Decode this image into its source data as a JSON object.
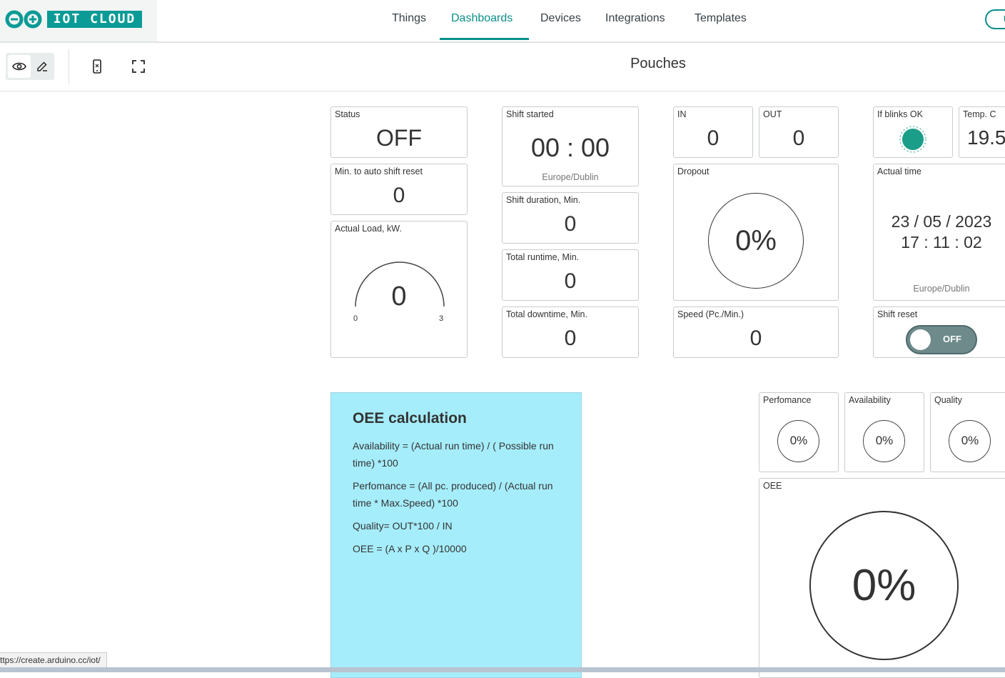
{
  "app": {
    "logo_text": "IOT CLOUD"
  },
  "nav": {
    "items": [
      {
        "label": "Things"
      },
      {
        "label": "Dashboards"
      },
      {
        "label": "Devices"
      },
      {
        "label": "Integrations"
      },
      {
        "label": "Templates"
      }
    ],
    "active": "Dashboards",
    "right_button_label": "U"
  },
  "toolbar": {
    "dashboard_title": "Pouches"
  },
  "widgets": {
    "status": {
      "label": "Status",
      "value": "OFF"
    },
    "auto_reset": {
      "label": "Min. to auto shift reset",
      "value": "0"
    },
    "actual_load": {
      "label": "Actual Load, kW.",
      "value": "0",
      "min": "0",
      "max": "3"
    },
    "shift_started": {
      "label": "Shift started",
      "value": "00 : 00",
      "timezone": "Europe/Dublin"
    },
    "shift_duration": {
      "label": "Shift duration, Min.",
      "value": "0"
    },
    "total_runtime": {
      "label": "Total runtime, Min.",
      "value": "0"
    },
    "total_downtime": {
      "label": "Total downtime, Min.",
      "value": "0"
    },
    "in": {
      "label": "IN",
      "value": "0"
    },
    "out": {
      "label": "OUT",
      "value": "0"
    },
    "dropout": {
      "label": "Dropout",
      "value": "0%"
    },
    "speed": {
      "label": "Speed (Pc./Min.)",
      "value": "0"
    },
    "blink": {
      "label": "If blinks OK",
      "color": "#1a9e8a"
    },
    "temp": {
      "label": "Temp. C",
      "value": "19.5"
    },
    "actual_time": {
      "label": "Actual time",
      "date": "23 / 05 / 2023",
      "time": "17 : 11 : 02",
      "timezone": "Europe/Dublin"
    },
    "shift_reset": {
      "label": "Shift reset",
      "state": "OFF"
    },
    "performance": {
      "label": "Perfomance",
      "value": "0%"
    },
    "availability": {
      "label": "Availability",
      "value": "0%"
    },
    "quality": {
      "label": "Quality",
      "value": "0%"
    },
    "oee": {
      "label": "OEE",
      "value": "0%"
    }
  },
  "note": {
    "title": "OEE calculation",
    "lines": [
      "Availability = (Actual run time) / ( Possible run time) *100",
      "Perfomance = (All pc. produced) / (Actual run time * Max.Speed) *100",
      "Quality= OUT*100 / IN",
      "OEE = (A x P x Q )/10000"
    ]
  },
  "status_bar": {
    "url": "ttps://create.arduino.cc/iot/"
  },
  "colors": {
    "accent": "#0a8f8a",
    "note_bg": "#a6edfb",
    "led": "#1a9e8a"
  }
}
